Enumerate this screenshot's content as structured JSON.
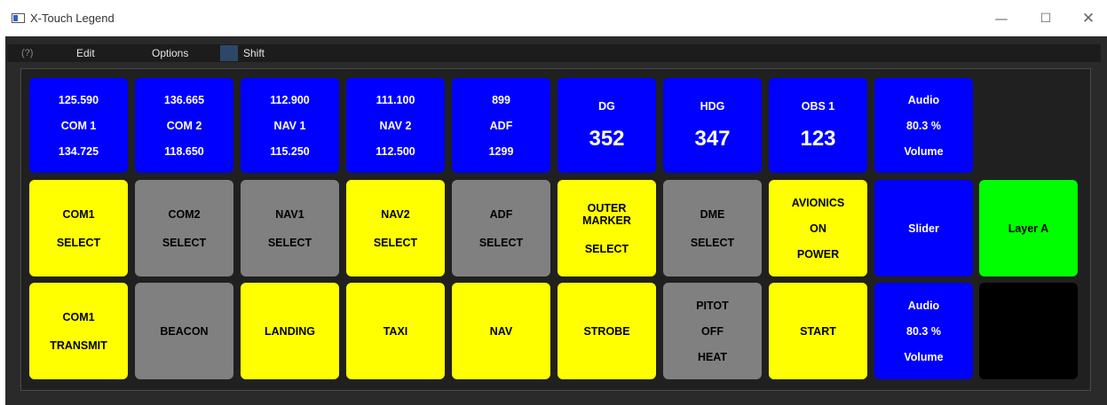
{
  "window": {
    "title": "X-Touch Legend",
    "minimize_glyph": "—",
    "maximize_glyph": "☐",
    "close_glyph": "✕"
  },
  "menu": {
    "help": "(?)",
    "edit": "Edit",
    "options": "Options",
    "shift": "Shift"
  },
  "colors": {
    "blue": "#0000ff",
    "yellow": "#ffff00",
    "gray": "#808080",
    "green": "#00ff00",
    "black": "#000000"
  },
  "rows": {
    "top": [
      {
        "color": "blue",
        "lines": [
          "125.590",
          "COM 1",
          "134.725"
        ]
      },
      {
        "color": "blue",
        "lines": [
          "136.665",
          "COM 2",
          "118.650"
        ]
      },
      {
        "color": "blue",
        "lines": [
          "112.900",
          "NAV 1",
          "115.250"
        ]
      },
      {
        "color": "blue",
        "lines": [
          "111.100",
          "NAV 2",
          "112.500"
        ]
      },
      {
        "color": "blue",
        "lines": [
          "899",
          "ADF",
          "1299"
        ]
      },
      {
        "color": "blue",
        "lines": [
          "DG",
          "352"
        ]
      },
      {
        "color": "blue",
        "lines": [
          "HDG",
          "347"
        ]
      },
      {
        "color": "blue",
        "lines": [
          "OBS 1",
          "123"
        ]
      },
      {
        "color": "blue",
        "lines": [
          "Audio",
          "80.3 %",
          "Volume"
        ]
      }
    ],
    "middle": [
      {
        "color": "yellow",
        "lines": [
          "COM1",
          "SELECT"
        ]
      },
      {
        "color": "gray",
        "lines": [
          "COM2",
          "SELECT"
        ]
      },
      {
        "color": "gray",
        "lines": [
          "NAV1",
          "SELECT"
        ]
      },
      {
        "color": "yellow",
        "lines": [
          "NAV2",
          "SELECT"
        ]
      },
      {
        "color": "gray",
        "lines": [
          "ADF",
          "SELECT"
        ]
      },
      {
        "color": "yellow",
        "lines": [
          "OUTER",
          "MARKER",
          "SELECT"
        ]
      },
      {
        "color": "gray",
        "lines": [
          "DME",
          "SELECT"
        ]
      },
      {
        "color": "yellow",
        "lines": [
          "AVIONICS",
          "ON",
          "POWER"
        ]
      },
      {
        "color": "blue",
        "lines": [
          "Slider"
        ]
      },
      {
        "color": "green",
        "lines": [
          "Layer A"
        ]
      }
    ],
    "bottom": [
      {
        "color": "yellow",
        "lines": [
          "COM1",
          "TRANSMIT"
        ]
      },
      {
        "color": "gray",
        "lines": [
          "BEACON"
        ]
      },
      {
        "color": "yellow",
        "lines": [
          "LANDING"
        ]
      },
      {
        "color": "yellow",
        "lines": [
          "TAXI"
        ]
      },
      {
        "color": "yellow",
        "lines": [
          "NAV"
        ]
      },
      {
        "color": "yellow",
        "lines": [
          "STROBE"
        ]
      },
      {
        "color": "gray",
        "lines": [
          "PITOT",
          "OFF",
          "HEAT"
        ]
      },
      {
        "color": "yellow",
        "lines": [
          "START"
        ]
      },
      {
        "color": "blue",
        "lines": [
          "Audio",
          "80.3 %",
          "Volume"
        ]
      },
      {
        "color": "black",
        "lines": []
      }
    ]
  }
}
